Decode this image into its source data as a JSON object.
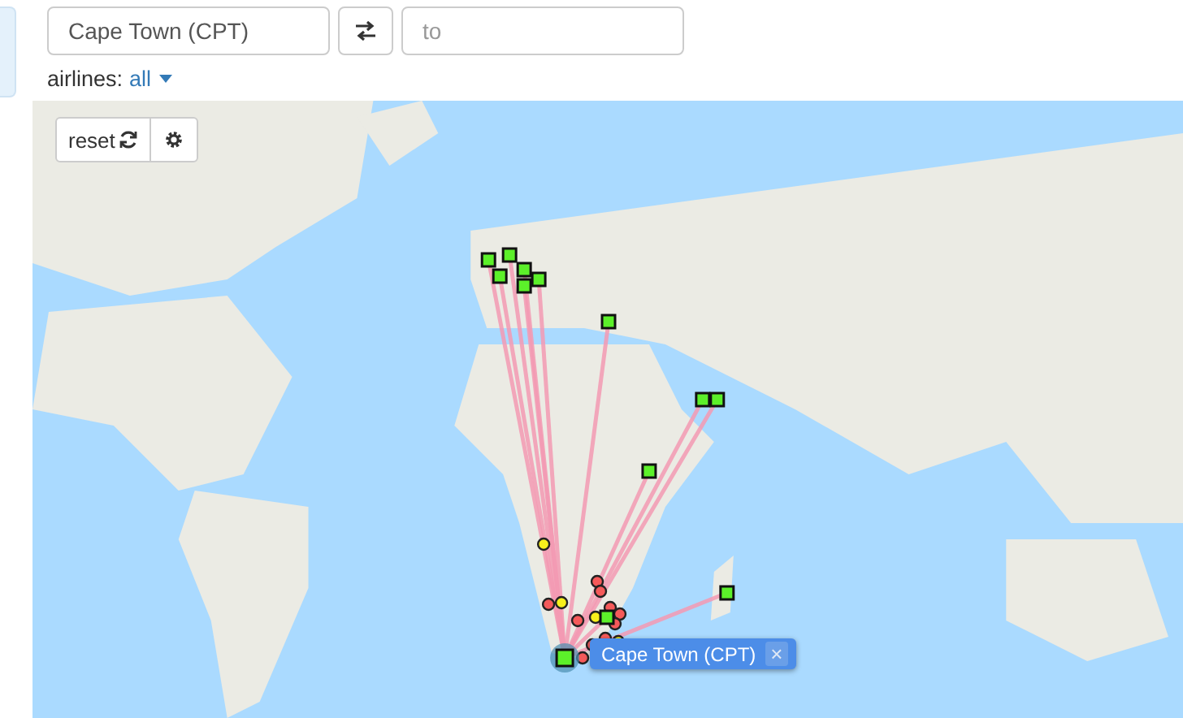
{
  "search": {
    "from_value": "Cape Town (CPT)",
    "to_placeholder": "to"
  },
  "filter": {
    "label": "airlines:",
    "value": "all"
  },
  "map_controls": {
    "reset_label": "reset"
  },
  "airport_tag": {
    "label": "Cape Town (CPT)",
    "close": "×"
  }
}
